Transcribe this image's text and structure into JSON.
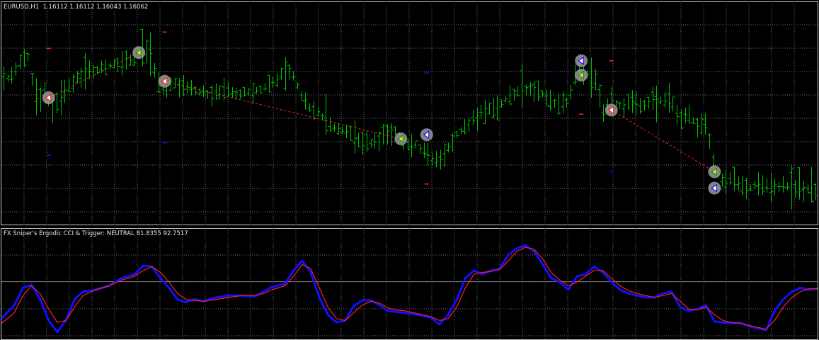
{
  "colors": {
    "background": "#000000",
    "grid": "#6e6e6e",
    "frame": "#c8c8c8",
    "bars": "#00c000",
    "text": "#e6e6e6",
    "cci": "#1010ff",
    "trigger": "#ff2020",
    "sell_trend": "#ff2020",
    "buy_trend": "#1010ff"
  },
  "main_title": "EURUSD,H1  1.16112 1.16112 1.16043 1.16062",
  "indicator_title": "FX Sniper's Ergodic CCI & Trigger: NEUTRAL 81.8355 92.7517",
  "chart_data": [
    {
      "type": "ohlc",
      "symbol": "EURUSD",
      "timeframe": "H1",
      "last_ohlc": {
        "open": 1.16112,
        "high": 1.16112,
        "low": 1.16043,
        "close": 1.16062
      },
      "grid": true,
      "xlim": [
        0,
        190
      ],
      "ylim": [
        0,
        100
      ],
      "price_path": [
        [
          0,
          67
        ],
        [
          3,
          73
        ],
        [
          6,
          82
        ],
        [
          8,
          58
        ],
        [
          10,
          62
        ],
        [
          12,
          55
        ],
        [
          15,
          64
        ],
        [
          18,
          70
        ],
        [
          22,
          74
        ],
        [
          26,
          76
        ],
        [
          30,
          78
        ],
        [
          32,
          82
        ],
        [
          34,
          84
        ],
        [
          36,
          70
        ],
        [
          38,
          64
        ],
        [
          40,
          67
        ],
        [
          44,
          64
        ],
        [
          48,
          62
        ],
        [
          52,
          63
        ],
        [
          56,
          62
        ],
        [
          60,
          64
        ],
        [
          64,
          68
        ],
        [
          66,
          74
        ],
        [
          68,
          70
        ],
        [
          70,
          60
        ],
        [
          72,
          55
        ],
        [
          74,
          52
        ],
        [
          76,
          48
        ],
        [
          78,
          44
        ],
        [
          80,
          45
        ],
        [
          82,
          40
        ],
        [
          84,
          39
        ],
        [
          86,
          38
        ],
        [
          88,
          40
        ],
        [
          90,
          42
        ],
        [
          92,
          44
        ],
        [
          94,
          37
        ],
        [
          96,
          38
        ],
        [
          98,
          34
        ],
        [
          100,
          31
        ],
        [
          102,
          28
        ],
        [
          104,
          36
        ],
        [
          106,
          42
        ],
        [
          108,
          46
        ],
        [
          110,
          50
        ],
        [
          112,
          53
        ],
        [
          114,
          55
        ],
        [
          116,
          56
        ],
        [
          118,
          61
        ],
        [
          120,
          63
        ],
        [
          122,
          64
        ],
        [
          124,
          63
        ],
        [
          126,
          62
        ],
        [
          128,
          58
        ],
        [
          130,
          57
        ],
        [
          132,
          58
        ],
        [
          134,
          75
        ],
        [
          136,
          72
        ],
        [
          138,
          70
        ],
        [
          140,
          52
        ],
        [
          142,
          59
        ],
        [
          144,
          56
        ],
        [
          146,
          57
        ],
        [
          148,
          56
        ],
        [
          150,
          57
        ],
        [
          152,
          60
        ],
        [
          154,
          58
        ],
        [
          156,
          58
        ],
        [
          158,
          50
        ],
        [
          160,
          52
        ],
        [
          162,
          46
        ],
        [
          164,
          48
        ],
        [
          166,
          26
        ],
        [
          168,
          18
        ],
        [
          170,
          22
        ],
        [
          172,
          18
        ],
        [
          174,
          16
        ],
        [
          176,
          18
        ],
        [
          178,
          18
        ],
        [
          180,
          16
        ],
        [
          182,
          17
        ],
        [
          184,
          16
        ],
        [
          186,
          16
        ],
        [
          188,
          16
        ],
        [
          190,
          15
        ]
      ],
      "signals": [
        {
          "x": 11,
          "price": 60,
          "kind": "buy-arrow"
        },
        {
          "x": 32,
          "price": 82,
          "kind": "sell-arrow"
        },
        {
          "x": 38,
          "price": 68,
          "kind": "buy-arrow"
        },
        {
          "x": 93,
          "price": 40,
          "kind": "sell-arrow"
        },
        {
          "x": 99,
          "price": 42,
          "kind": "buy-arrow-blue"
        },
        {
          "x": 135,
          "price": 78,
          "kind": "buy-arrow-blue"
        },
        {
          "x": 135,
          "price": 71,
          "kind": "sell-arrow"
        },
        {
          "x": 142,
          "price": 54,
          "kind": "buy-arrow"
        },
        {
          "x": 166,
          "price": 24,
          "kind": "sell-arrow"
        },
        {
          "x": 166,
          "price": 16,
          "kind": "buy-arrow-blue"
        }
      ],
      "trend_lines": [
        {
          "from": [
            0,
            82
          ],
          "to": [
            11,
            63
          ],
          "style": "blue-dots"
        },
        {
          "from": [
            11,
            60
          ],
          "to": [
            32,
            82
          ],
          "style": "red-dash"
        },
        {
          "from": [
            38,
            68
          ],
          "to": [
            93,
            40
          ],
          "style": "red-dash"
        },
        {
          "from": [
            99,
            42
          ],
          "to": [
            135,
            78
          ],
          "style": "blue-dots"
        },
        {
          "from": [
            142,
            54
          ],
          "to": [
            166,
            24
          ],
          "style": "red-dash"
        },
        {
          "from": [
            166,
            16
          ],
          "to": [
            190,
            8
          ],
          "style": "blue-dots"
        }
      ],
      "small_marks": [
        {
          "x": 38,
          "price": 92,
          "color": "red"
        },
        {
          "x": 11,
          "price": 84,
          "color": "red"
        },
        {
          "x": 11,
          "price": 32,
          "color": "blue"
        },
        {
          "x": 38,
          "price": 38,
          "color": "blue"
        },
        {
          "x": 99,
          "price": 72,
          "color": "blue"
        },
        {
          "x": 99,
          "price": 18,
          "color": "red"
        },
        {
          "x": 142,
          "price": 78,
          "color": "red"
        },
        {
          "x": 135,
          "price": 52,
          "color": "red"
        },
        {
          "x": 142,
          "price": 24,
          "color": "blue"
        }
      ]
    },
    {
      "type": "line",
      "title": "FX Sniper's Ergodic CCI & Trigger: NEUTRAL 81.8355 92.7517",
      "grid": true,
      "xlim": [
        0,
        190
      ],
      "ylim": [
        0,
        100
      ],
      "series": [
        {
          "name": "CCI",
          "color": "#1010ff",
          "points": [
            [
              0,
              20
            ],
            [
              3,
              34
            ],
            [
              5,
              52
            ],
            [
              7,
              55
            ],
            [
              9,
              40
            ],
            [
              11,
              18
            ],
            [
              13,
              6
            ],
            [
              15,
              18
            ],
            [
              17,
              40
            ],
            [
              19,
              48
            ],
            [
              22,
              50
            ],
            [
              25,
              54
            ],
            [
              28,
              62
            ],
            [
              31,
              66
            ],
            [
              33,
              75
            ],
            [
              35,
              74
            ],
            [
              37,
              62
            ],
            [
              39,
              52
            ],
            [
              41,
              40
            ],
            [
              43,
              37
            ],
            [
              45,
              40
            ],
            [
              47,
              38
            ],
            [
              50,
              42
            ],
            [
              53,
              44
            ],
            [
              56,
              44
            ],
            [
              59,
              43
            ],
            [
              61,
              48
            ],
            [
              63,
              53
            ],
            [
              66,
              56
            ],
            [
              68,
              70
            ],
            [
              70,
              80
            ],
            [
              72,
              68
            ],
            [
              74,
              42
            ],
            [
              76,
              24
            ],
            [
              78,
              16
            ],
            [
              80,
              18
            ],
            [
              82,
              33
            ],
            [
              84,
              39
            ],
            [
              86,
              39
            ],
            [
              88,
              34
            ],
            [
              90,
              28
            ],
            [
              92,
              27
            ],
            [
              94,
              26
            ],
            [
              97,
              24
            ],
            [
              100,
              21
            ],
            [
              102,
              14
            ],
            [
              104,
              24
            ],
            [
              106,
              40
            ],
            [
              108,
              62
            ],
            [
              110,
              70
            ],
            [
              112,
              66
            ],
            [
              114,
              70
            ],
            [
              116,
              72
            ],
            [
              118,
              86
            ],
            [
              120,
              93
            ],
            [
              122,
              96
            ],
            [
              124,
              90
            ],
            [
              126,
              76
            ],
            [
              128,
              62
            ],
            [
              130,
              58
            ],
            [
              132,
              50
            ],
            [
              134,
              64
            ],
            [
              136,
              66
            ],
            [
              138,
              74
            ],
            [
              140,
              68
            ],
            [
              142,
              58
            ],
            [
              144,
              50
            ],
            [
              146,
              46
            ],
            [
              148,
              44
            ],
            [
              150,
              42
            ],
            [
              152,
              42
            ],
            [
              154,
              46
            ],
            [
              156,
              48
            ],
            [
              158,
              32
            ],
            [
              160,
              28
            ],
            [
              162,
              30
            ],
            [
              164,
              34
            ],
            [
              166,
              17
            ],
            [
              168,
              16
            ],
            [
              170,
              15
            ],
            [
              172,
              16
            ],
            [
              174,
              12
            ],
            [
              176,
              10
            ],
            [
              178,
              8
            ],
            [
              180,
              28
            ],
            [
              182,
              40
            ],
            [
              184,
              48
            ],
            [
              186,
              52
            ],
            [
              188,
              50
            ],
            [
              190,
              51
            ]
          ]
        },
        {
          "name": "Trigger",
          "color": "#ff2020",
          "points": [
            [
              0,
              15
            ],
            [
              3,
              26
            ],
            [
              5,
              44
            ],
            [
              7,
              54
            ],
            [
              9,
              46
            ],
            [
              11,
              30
            ],
            [
              13,
              16
            ],
            [
              15,
              18
            ],
            [
              17,
              32
            ],
            [
              19,
              44
            ],
            [
              22,
              50
            ],
            [
              25,
              54
            ],
            [
              28,
              60
            ],
            [
              31,
              64
            ],
            [
              33,
              70
            ],
            [
              35,
              74
            ],
            [
              37,
              68
            ],
            [
              39,
              58
            ],
            [
              41,
              46
            ],
            [
              43,
              40
            ],
            [
              45,
              39
            ],
            [
              47,
              38
            ],
            [
              50,
              40
            ],
            [
              53,
              42
            ],
            [
              56,
              44
            ],
            [
              59,
              44
            ],
            [
              61,
              46
            ],
            [
              63,
              50
            ],
            [
              66,
              54
            ],
            [
              68,
              64
            ],
            [
              70,
              76
            ],
            [
              72,
              72
            ],
            [
              74,
              52
            ],
            [
              76,
              32
            ],
            [
              78,
              20
            ],
            [
              80,
              18
            ],
            [
              82,
              26
            ],
            [
              84,
              34
            ],
            [
              86,
              38
            ],
            [
              88,
              36
            ],
            [
              90,
              31
            ],
            [
              92,
              29
            ],
            [
              94,
              28
            ],
            [
              97,
              25
            ],
            [
              100,
              22
            ],
            [
              102,
              18
            ],
            [
              104,
              20
            ],
            [
              106,
              32
            ],
            [
              108,
              52
            ],
            [
              110,
              66
            ],
            [
              112,
              68
            ],
            [
              114,
              69
            ],
            [
              116,
              71
            ],
            [
              118,
              80
            ],
            [
              120,
              90
            ],
            [
              122,
              94
            ],
            [
              124,
              92
            ],
            [
              126,
              82
            ],
            [
              128,
              68
            ],
            [
              130,
              60
            ],
            [
              132,
              54
            ],
            [
              134,
              58
            ],
            [
              136,
              64
            ],
            [
              138,
              70
            ],
            [
              140,
              70
            ],
            [
              142,
              62
            ],
            [
              144,
              54
            ],
            [
              146,
              49
            ],
            [
              148,
              46
            ],
            [
              150,
              44
            ],
            [
              152,
              42
            ],
            [
              154,
              44
            ],
            [
              156,
              46
            ],
            [
              158,
              38
            ],
            [
              160,
              30
            ],
            [
              162,
              29
            ],
            [
              164,
              32
            ],
            [
              166,
              24
            ],
            [
              168,
              18
            ],
            [
              170,
              16
            ],
            [
              172,
              15
            ],
            [
              174,
              13
            ],
            [
              176,
              11
            ],
            [
              178,
              9
            ],
            [
              180,
              18
            ],
            [
              182,
              32
            ],
            [
              184,
              42
            ],
            [
              186,
              48
            ],
            [
              188,
              51
            ],
            [
              190,
              51
            ]
          ]
        }
      ]
    }
  ]
}
